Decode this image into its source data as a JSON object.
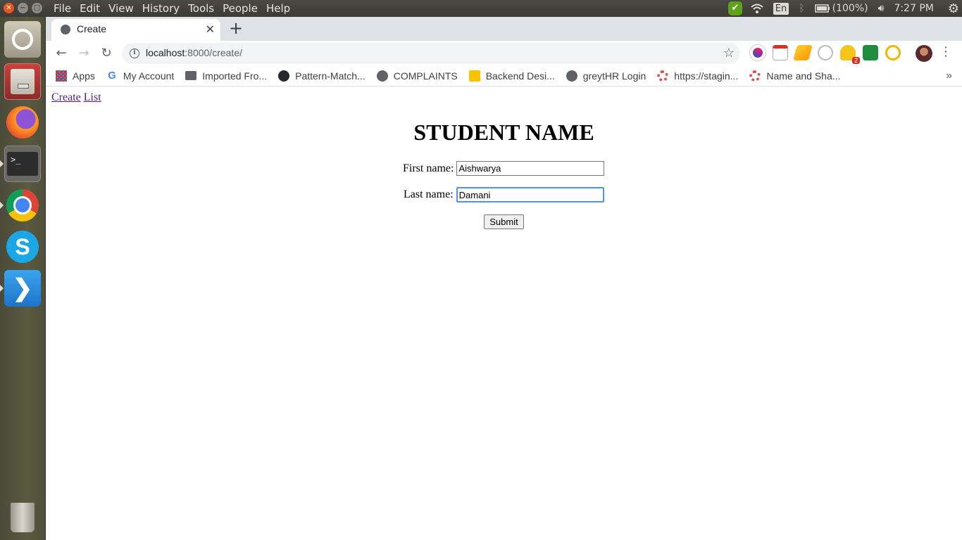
{
  "system": {
    "menus": [
      "File",
      "Edit",
      "View",
      "History",
      "Tools",
      "People",
      "Help"
    ],
    "language": "En",
    "battery": "(100%)",
    "clock": "7:27 PM"
  },
  "browser": {
    "tab_title": "Create",
    "url_host": "localhost",
    "url_rest": ":8000/create/",
    "bookmarks": {
      "apps": "Apps",
      "my_account": "My Account",
      "imported": "Imported Fro...",
      "pattern": "Pattern-Match...",
      "complaints": "COMPLAINTS",
      "backend": "Backend Desi...",
      "greythr": "greytHR Login",
      "staging": "https://stagin...",
      "name_shape": "Name and Sha..."
    },
    "extension_badge": "2"
  },
  "page": {
    "nav_create": "Create",
    "nav_list": "List",
    "heading": "STUDENT NAME",
    "first_label": "First name:",
    "first_value": "Aishwarya",
    "last_label": "Last name:",
    "last_value": "Damani",
    "submit_label": "Submit"
  }
}
